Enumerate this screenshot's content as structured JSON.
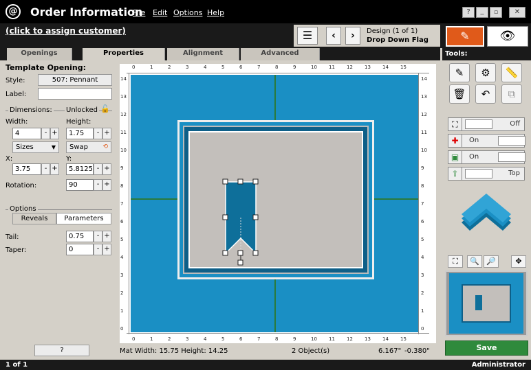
{
  "app": {
    "title": "Order Information",
    "menu": [
      "File",
      "Edit",
      "Options",
      "Help"
    ]
  },
  "customer_link": "(click to assign customer)",
  "design": {
    "label": "Design (1 of 1)",
    "name": "Drop Down Flag"
  },
  "tabs": [
    "Openings",
    "Properties",
    "Alignment",
    "Advanced"
  ],
  "props": {
    "header": "Template Opening:",
    "style_label": "Style:",
    "style_value": "507: Pennant",
    "label_label": "Label:",
    "label_value": "",
    "dimensions": "Dimensions:",
    "unlocked": "Unlocked",
    "width_label": "Width:",
    "width_value": "4",
    "height_label": "Height:",
    "height_value": "1.75",
    "sizes": "Sizes",
    "swap": "Swap",
    "x_label": "X:",
    "x_value": "3.75",
    "y_label": "Y:",
    "y_value": "5.8125",
    "rotation_label": "Rotation:",
    "rotation_value": "90",
    "options": "Options",
    "reveals": "Reveals",
    "parameters": "Parameters",
    "tail_label": "Tail:",
    "tail_value": "0.75",
    "taper_label": "Taper:",
    "taper_value": "0",
    "help": "?"
  },
  "ruler": {
    "h": [
      "0",
      "1",
      "2",
      "3",
      "4",
      "5",
      "6",
      "7",
      "8",
      "9",
      "10",
      "11",
      "12",
      "13",
      "14",
      "15"
    ],
    "v": [
      "14",
      "13",
      "12",
      "11",
      "10",
      "9",
      "8",
      "7",
      "6",
      "5",
      "4",
      "3",
      "2",
      "1",
      "0"
    ]
  },
  "status": {
    "mat": "Mat  Width: 15.75  Height: 14.25",
    "objects": "2 Object(s)",
    "x": "6.167\"",
    "y": "-0.380\""
  },
  "tools": {
    "header": "Tools:",
    "toggle1": "Off",
    "toggle2": "On",
    "toggle3": "On",
    "toggle4": "Top",
    "save": "Save"
  },
  "footer": {
    "page": "1 of 1",
    "user": "Administrator"
  },
  "colors": {
    "mat": "#1a8fc4",
    "accent": "#e05a1a",
    "save": "#2f8a3c"
  }
}
